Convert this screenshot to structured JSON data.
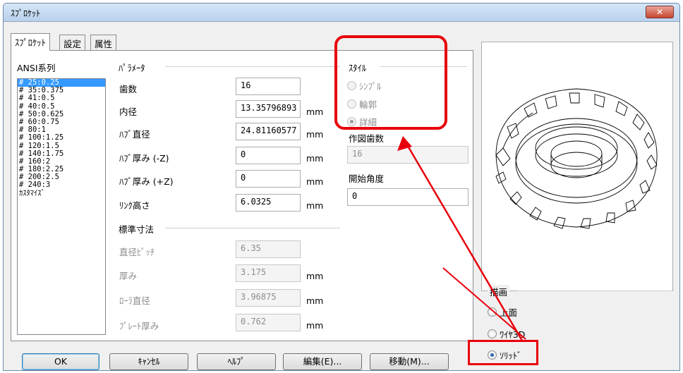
{
  "window": {
    "title": "ｽﾌﾟﾛｹｯﾄ",
    "close_label": "✕"
  },
  "tabs": [
    {
      "label": "ｽﾌﾟﾛｹｯﾄ"
    },
    {
      "label": "設定"
    },
    {
      "label": "属性"
    }
  ],
  "ansi": {
    "label": "ANSI系列",
    "items": [
      "# 25:0.25",
      "# 35:0.375",
      "# 41:0.5",
      "# 40:0.5",
      "# 50:0.625",
      "# 60:0.75",
      "# 80:1",
      "# 100:1.25",
      "# 120:1.5",
      "# 140:1.75",
      "# 160:2",
      "# 180:2.25",
      "# 200:2.5",
      "# 240:3",
      "ｶｽﾀﾏｲｽﾞ"
    ],
    "selected_index": 0
  },
  "params": {
    "group_label": "ﾊﾟﾗﾒｰﾀ",
    "teeth_label": "歯数",
    "teeth_value": "16",
    "inner_dia_label": "内径",
    "inner_dia_value": "13.35796893",
    "inner_dia_unit": "mm",
    "hub_dia_label": "ﾊﾌﾞ直径",
    "hub_dia_value": "24.81160577",
    "hub_dia_unit": "mm",
    "hub_thick_neg_label": "ﾊﾌﾞ厚み (-Z)",
    "hub_thick_neg_value": "0",
    "hub_thick_neg_unit": "mm",
    "hub_thick_pos_label": "ﾊﾌﾞ厚み (+Z)",
    "hub_thick_pos_value": "0",
    "hub_thick_pos_unit": "mm",
    "link_height_label": "ﾘﾝｸ高さ",
    "link_height_value": "6.0325",
    "link_height_unit": "mm"
  },
  "standard": {
    "group_label": "標準寸法",
    "pitch_label": "直径ﾋﾟｯﾁ",
    "pitch_value": "6.35",
    "thickness_label": "厚み",
    "thickness_value": "3.175",
    "thickness_unit": "mm",
    "roller_label": "ﾛｰﾗ直径",
    "roller_value": "3.96875",
    "roller_unit": "mm",
    "plate_label": "ﾌﾟﾚｰﾄ厚み",
    "plate_value": "0.762",
    "plate_unit": "mm"
  },
  "style": {
    "group_label": "ｽﾀｲﾙ",
    "options": [
      "ｼﾝﾌﾟﾙ",
      "輪郭",
      "詳細"
    ],
    "selected_index": 2,
    "draw_teeth_label": "作図歯数",
    "draw_teeth_value": "16",
    "start_angle_label": "開始角度",
    "start_angle_value": "0"
  },
  "render": {
    "group_label": "描画",
    "options": [
      "上面",
      "ﾜｲﾔ3D",
      "ｿﾘｯﾄﾞ"
    ],
    "selected_index": 2
  },
  "buttons": {
    "ok": "OK",
    "cancel": "ｷｬﾝｾﾙ",
    "help": "ﾍﾙﾌﾟ",
    "edit": "編集(E)...",
    "move": "移動(M)..."
  },
  "colors": {
    "highlight": "#e8000b",
    "selection": "#3399ff"
  }
}
